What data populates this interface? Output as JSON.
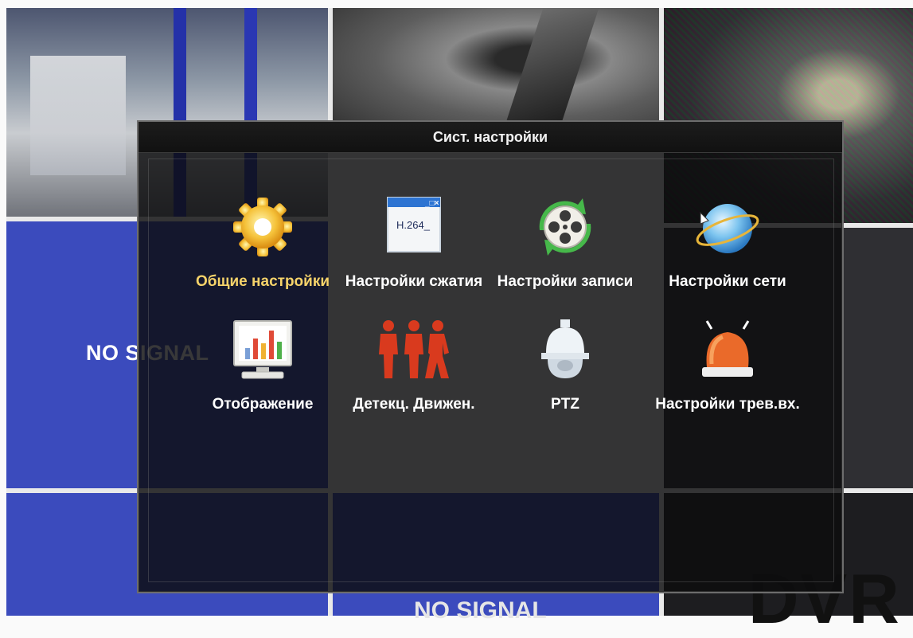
{
  "background": {
    "no_signal_left": "NO SIGNAL",
    "no_signal_bottom": "NO SIGNAL",
    "dvr_brand": "DVR"
  },
  "menu": {
    "title": "Сист. настройки",
    "items": [
      {
        "label": "Общие настройки",
        "icon": "gear-icon",
        "selected": true
      },
      {
        "label": "Настройки сжатия",
        "icon": "h264-window-icon",
        "icon_text": "H.264_"
      },
      {
        "label": "Настройки записи",
        "icon": "film-reel-icon"
      },
      {
        "label": "Настройки сети",
        "icon": "globe-icon"
      },
      {
        "label": "Отображение",
        "icon": "monitor-chart-icon"
      },
      {
        "label": "Детекц. Движен.",
        "icon": "motion-figures-icon"
      },
      {
        "label": "PTZ",
        "icon": "dome-camera-icon"
      },
      {
        "label": "Настройки трев.вх.",
        "icon": "alarm-siren-icon"
      }
    ]
  },
  "colors": {
    "selected_label": "#f6d36a",
    "label": "#ffffff",
    "no_signal_bg": "#3b4bbd"
  }
}
